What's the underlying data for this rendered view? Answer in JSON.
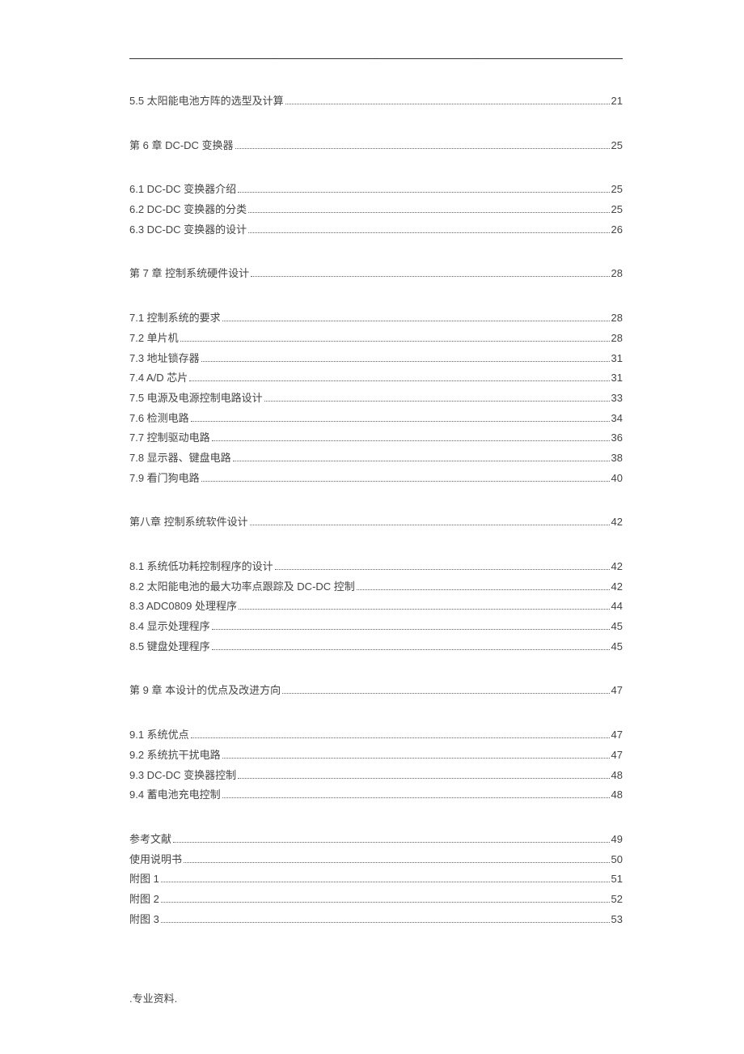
{
  "header_marks": [
    "..",
    "..",
    ".."
  ],
  "footer": ".专业资料.",
  "toc": [
    {
      "label": "5.5 太阳能电池方阵的选型及计算",
      "page": "21",
      "chapter": false,
      "group": "top"
    },
    {
      "label": "第 6 章   DC-DC 变换器",
      "page": "25",
      "chapter": true
    },
    {
      "label": "6.1 DC-DC 变换器介绍",
      "page": "25",
      "chapter": false
    },
    {
      "label": "6.2 DC-DC 变换器的分类",
      "page": "25",
      "chapter": false
    },
    {
      "label": "6.3 DC-DC 变换器的设计",
      "page": "26",
      "chapter": false
    },
    {
      "label": "第 7 章   控制系统硬件设计",
      "page": "28",
      "chapter": true
    },
    {
      "label": "7.1 控制系统的要求",
      "page": "28",
      "chapter": false
    },
    {
      "label": "7.2 单片机",
      "page": "28",
      "chapter": false
    },
    {
      "label": "7.3 地址锁存器",
      "page": "31",
      "chapter": false
    },
    {
      "label": "7.4 A/D 芯片",
      "page": "31",
      "chapter": false
    },
    {
      "label": "7.5 电源及电源控制电路设计",
      "page": "33",
      "chapter": false
    },
    {
      "label": "7.6 检测电路",
      "page": "34",
      "chapter": false
    },
    {
      "label": "7.7 控制驱动电路",
      "page": "36",
      "chapter": false
    },
    {
      "label": "7.8 显示器、键盘电路",
      "page": "38",
      "chapter": false
    },
    {
      "label": "7.9 看门狗电路",
      "page": "40",
      "chapter": false
    },
    {
      "label": "第八章   控制系统软件设计",
      "page": "42",
      "chapter": true
    },
    {
      "label": "8.1 系统低功耗控制程序的设计",
      "page": "42",
      "chapter": false
    },
    {
      "label": "8.2 太阳能电池的最大功率点跟踪及 DC-DC 控制",
      "page": "42",
      "chapter": false
    },
    {
      "label": "8.3 ADC0809 处理程序",
      "page": "44",
      "chapter": false
    },
    {
      "label": "8.4 显示处理程序",
      "page": "45",
      "chapter": false
    },
    {
      "label": "8.5 键盘处理程序",
      "page": "45",
      "chapter": false
    },
    {
      "label": "第 9 章   本设计的优点及改进方向",
      "page": "47",
      "chapter": true
    },
    {
      "label": "9.1 系统优点",
      "page": "47",
      "chapter": false
    },
    {
      "label": "9.2 系统抗干扰电路",
      "page": "47",
      "chapter": false
    },
    {
      "label": "9.3 DC-DC 变换器控制",
      "page": "48",
      "chapter": false
    },
    {
      "label": "9.4 蓄电池充电控制",
      "page": "48",
      "chapter": false
    },
    {
      "label": "参考文献",
      "page": "49",
      "chapter": false,
      "group": "end"
    },
    {
      "label": "使用说明书",
      "page": "50",
      "chapter": false,
      "group": "end"
    },
    {
      "label": "附图 1",
      "page": "51",
      "chapter": false,
      "group": "end"
    },
    {
      "label": "附图 2",
      "page": "52",
      "chapter": false,
      "group": "end"
    },
    {
      "label": "附图 3",
      "page": "53",
      "chapter": false,
      "group": "end"
    }
  ]
}
